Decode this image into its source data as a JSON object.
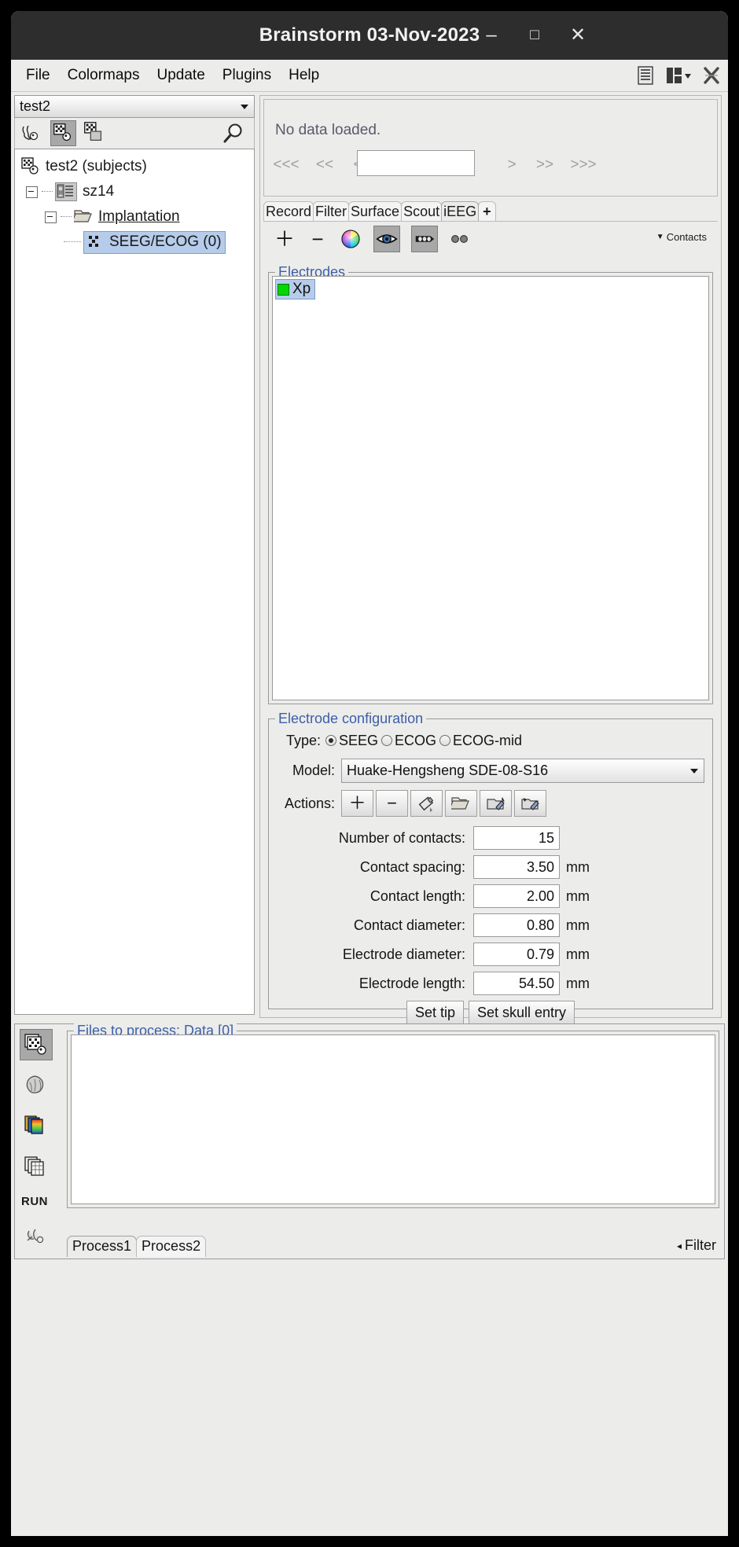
{
  "window": {
    "title": "Brainstorm 03-Nov-2023",
    "minimize": "–",
    "maximize": "□",
    "close": "✕"
  },
  "menubar": {
    "items": [
      {
        "label": "File"
      },
      {
        "label": "Colormaps"
      },
      {
        "label": "Update"
      },
      {
        "label": "Plugins"
      },
      {
        "label": "Help"
      }
    ],
    "right_icons": [
      {
        "name": "layout-report-icon"
      },
      {
        "name": "window-layout-icon"
      },
      {
        "name": "close-all-icon"
      }
    ]
  },
  "left_panel": {
    "protocol_selector": {
      "value": "test2"
    },
    "explorer_buttons": [
      {
        "name": "anatomy-view-button",
        "selected": false
      },
      {
        "name": "functional-subjects-view-button",
        "selected": true
      },
      {
        "name": "functional-conditions-view-button",
        "selected": false
      }
    ],
    "search_icon": "search-icon",
    "tree": [
      {
        "label": "test2 (subjects)",
        "icon": "protocol-icon",
        "level": 0,
        "selected": false,
        "expander": false,
        "underline": false
      },
      {
        "label": "sz14",
        "icon": "subject-icon",
        "level": 1,
        "selected": false,
        "expander": true,
        "underline": false
      },
      {
        "label": "Implantation",
        "icon": "folder-icon",
        "level": 2,
        "selected": false,
        "expander": true,
        "underline": true
      },
      {
        "label": "SEEG/ECOG (0)",
        "icon": "seeg-contacts-icon",
        "level": 3,
        "selected": true,
        "expander": false,
        "underline": false
      }
    ]
  },
  "right_panel": {
    "no_data_text": "No data loaded.",
    "nav_buttons": [
      "<<<",
      "<<",
      "<",
      ">",
      ">>",
      ">>>"
    ],
    "nav_input_value": "",
    "tabs": [
      {
        "label": "Record",
        "active": false
      },
      {
        "label": "Filter",
        "active": false
      },
      {
        "label": "Surface",
        "active": false
      },
      {
        "label": "Scout",
        "active": false
      },
      {
        "label": "iEEG",
        "active": true
      },
      {
        "label": "+",
        "active": false
      }
    ],
    "electrode_toolbar": {
      "add": "＋",
      "remove": "−",
      "color_button": "color-wheel-icon",
      "display_button": "eye-icon",
      "contacts_button": "electrode-icon",
      "pair_button": "two-dots-icon",
      "contacts_menu_label": "Contacts"
    },
    "electrodes_group": {
      "title": "Electrodes",
      "items": [
        {
          "name": "Xp",
          "color": "#00d800",
          "selected": true
        }
      ]
    },
    "config_group": {
      "title": "Electrode configuration",
      "type_label": "Type:",
      "type_options": [
        {
          "label": "SEEG",
          "selected": true
        },
        {
          "label": "ECOG",
          "selected": false
        },
        {
          "label": "ECOG-mid",
          "selected": false
        }
      ],
      "model_label": "Model:",
      "model_value": "Huake-Hengsheng SDE-08-S16",
      "actions_label": "Actions:",
      "action_buttons": [
        {
          "name": "add-electrode-button",
          "glyph": "＋"
        },
        {
          "name": "remove-electrode-button",
          "glyph": "−"
        },
        {
          "name": "edit-color-button",
          "glyph": "color-fill-icon"
        },
        {
          "name": "load-electrode-button",
          "glyph": "folder-open-icon"
        },
        {
          "name": "export-electrode-button",
          "glyph": "export-icon"
        },
        {
          "name": "import-electrode-button",
          "glyph": "import-icon"
        }
      ],
      "fields": [
        {
          "label": "Number of contacts:",
          "value": "15",
          "unit": ""
        },
        {
          "label": "Contact spacing:",
          "value": "3.50",
          "unit": "mm"
        },
        {
          "label": "Contact length:",
          "value": "2.00",
          "unit": "mm"
        },
        {
          "label": "Contact diameter:",
          "value": "0.80",
          "unit": "mm"
        },
        {
          "label": "Electrode diameter:",
          "value": "0.79",
          "unit": "mm"
        },
        {
          "label": "Electrode length:",
          "value": "54.50",
          "unit": "mm"
        }
      ],
      "buttons": [
        {
          "label": "Set tip"
        },
        {
          "label": "Set skull entry"
        }
      ]
    }
  },
  "process_panel": {
    "sidebar_buttons": [
      {
        "name": "process-recordings-button",
        "selected": true
      },
      {
        "name": "process-sources-button",
        "selected": false
      },
      {
        "name": "process-timefreq-button",
        "selected": false
      },
      {
        "name": "process-matrix-button",
        "selected": false
      }
    ],
    "run_label": "RUN",
    "pipeline_icon": "pipeline-icon",
    "files_group_title": "Files to process: Data [0]",
    "tabs": [
      {
        "label": "Process1",
        "active": true
      },
      {
        "label": "Process2",
        "active": false
      }
    ],
    "filter_label": "Filter",
    "filter_arrow": "◂"
  },
  "colors": {
    "titlebar_bg": "#2d2d2d",
    "panel_bg": "#ececeb",
    "group_title": "#3c5fa8",
    "selection": "#b6ccea",
    "electrode_green": "#00d800"
  }
}
